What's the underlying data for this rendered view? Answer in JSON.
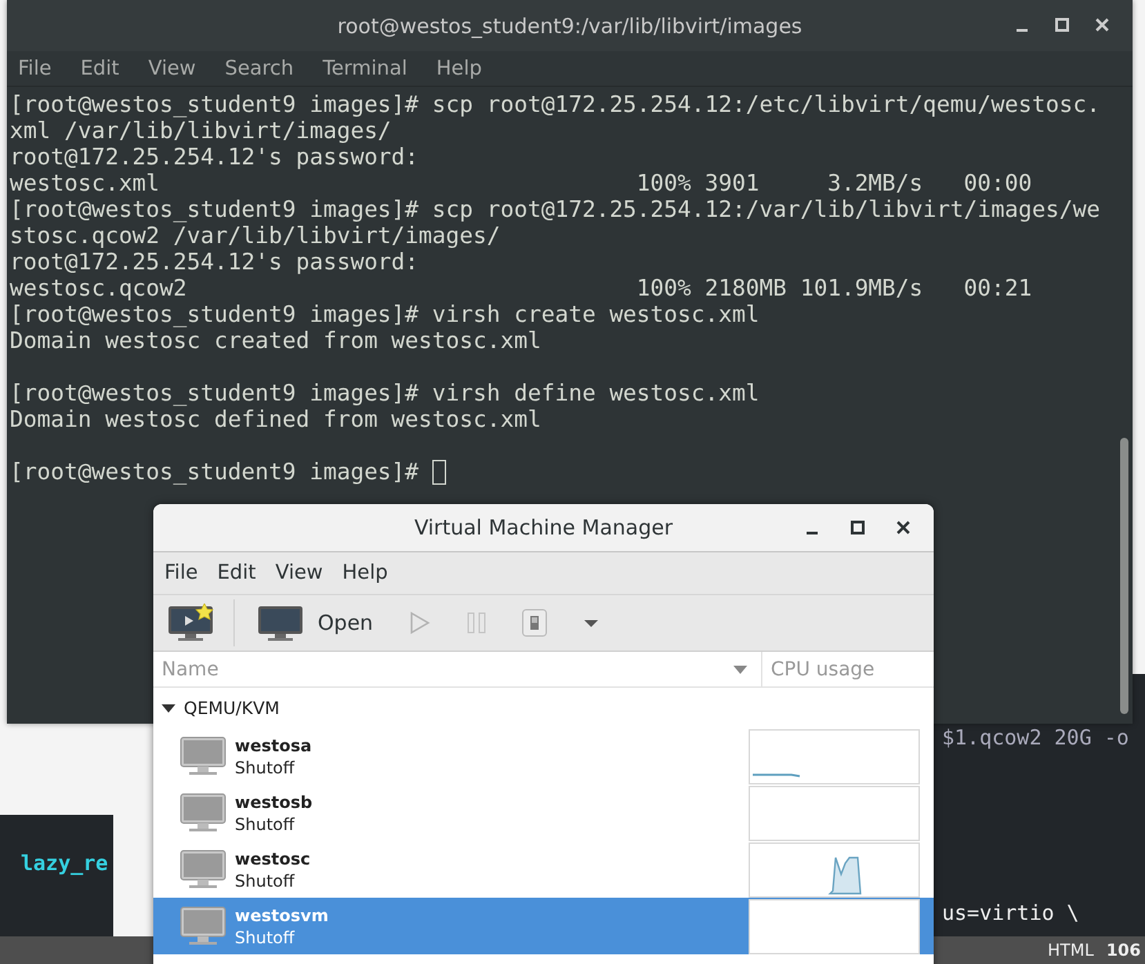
{
  "background": {
    "editor_left_text": "lazy_re",
    "editor_right_lines": [
      "$1.qcow2 20G -o",
      "us=virtio \\"
    ],
    "status_bar": [
      "HTML",
      "106"
    ]
  },
  "terminal": {
    "title": "root@westos_student9:/var/lib/libvirt/images",
    "menu": [
      "File",
      "Edit",
      "View",
      "Search",
      "Terminal",
      "Help"
    ],
    "blocks": [
      [
        "[root@westos_student9 images]# scp root@172.25.254.12:/etc/libvirt/qemu/westosc.",
        "xml /var/lib/libvirt/images/",
        "root@172.25.254.12's password:",
        "westosc.xml                                   100% 3901     3.2MB/s   00:00",
        "[root@westos_student9 images]# scp root@172.25.254.12:/var/lib/libvirt/images/we",
        "stosc.qcow2 /var/lib/libvirt/images/",
        "root@172.25.254.12's password:",
        "westosc.qcow2                                 100% 2180MB 101.9MB/s   00:21",
        "[root@westos_student9 images]# virsh create westosc.xml",
        "Domain westosc created from westosc.xml"
      ],
      [
        "[root@westos_student9 images]# virsh define westosc.xml",
        "Domain westosc defined from westosc.xml"
      ],
      [
        "[root@westos_student9 images]# "
      ]
    ],
    "cursor": true
  },
  "vmm": {
    "title": "Virtual Machine Manager",
    "menu": [
      "File",
      "Edit",
      "View",
      "Help"
    ],
    "toolbar": [
      {
        "kind": "new",
        "disabled": false
      },
      {
        "kind": "open",
        "label": "Open",
        "disabled": false
      },
      {
        "kind": "run",
        "disabled": true
      },
      {
        "kind": "pause",
        "disabled": true
      },
      {
        "kind": "shutdown",
        "disabled": false
      },
      {
        "kind": "menu",
        "disabled": false
      }
    ],
    "columns": [
      "Name",
      "CPU usage"
    ],
    "connection": {
      "name": "QEMU/KVM",
      "expanded": true
    },
    "vms": [
      {
        "name": "westosa",
        "status": "Shutoff",
        "selected": false
      },
      {
        "name": "westosb",
        "status": "Shutoff",
        "selected": false
      },
      {
        "name": "westosc",
        "status": "Shutoff",
        "selected": false
      },
      {
        "name": "westosvm",
        "status": "Shutoff",
        "selected": true
      }
    ]
  }
}
